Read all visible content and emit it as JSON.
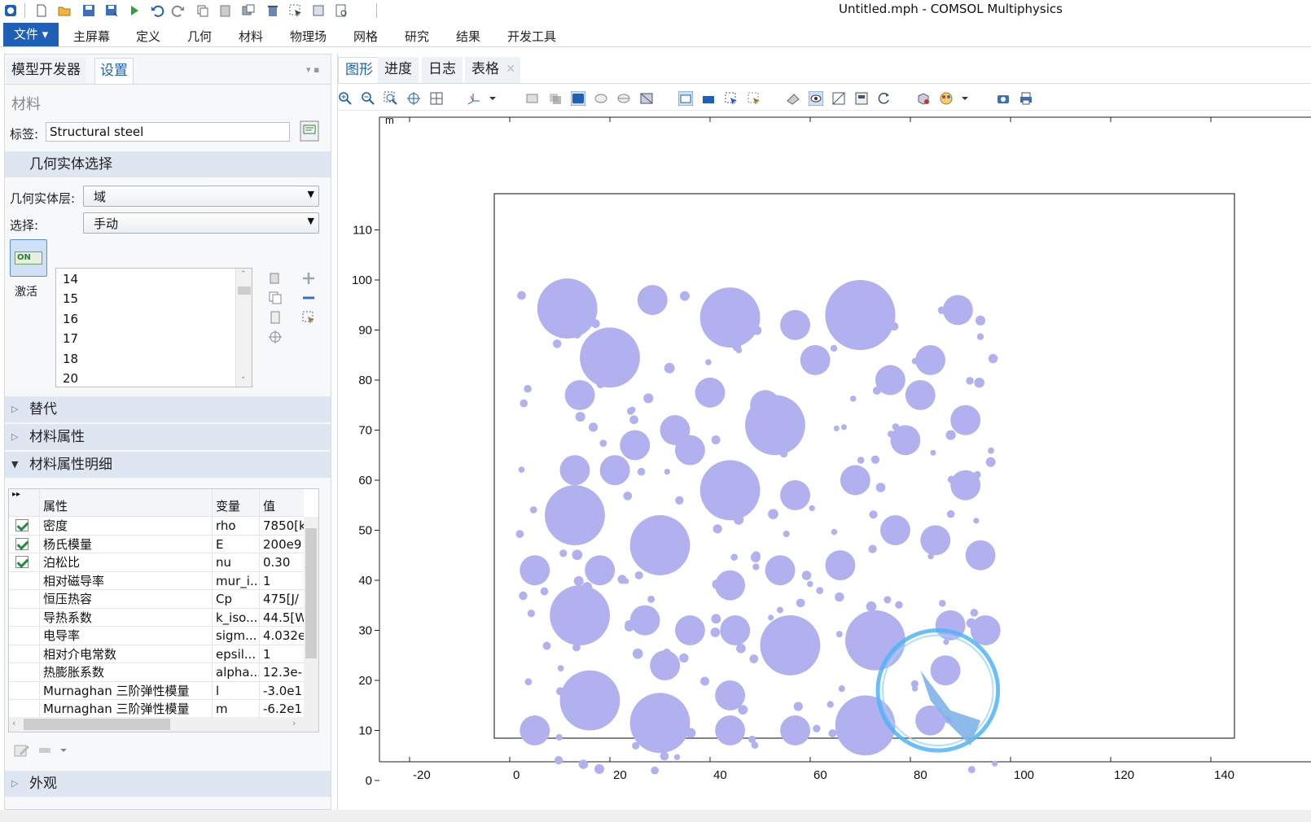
{
  "app": {
    "title": "Untitled.mph - COMSOL Multiphysics"
  },
  "ribbon": {
    "file_label": "文件 ▾",
    "tabs": [
      "主屏幕",
      "定义",
      "几何",
      "材料",
      "物理场",
      "网格",
      "研究",
      "结果",
      "开发工具"
    ]
  },
  "left": {
    "tabs": [
      "模型开发器",
      "设置"
    ],
    "section_title": "材料",
    "label_caption": "标签:",
    "label_value": "Structural steel",
    "geom_section": "几何实体选择",
    "level_caption": "几何实体层:",
    "level_value": "域",
    "selection_caption": "选择:",
    "selection_value": "手动",
    "activate_label": "激活",
    "toggle_text": "ON",
    "selection_items": [
      "14",
      "15",
      "16",
      "17",
      "18",
      "20"
    ],
    "sections": [
      "替代",
      "材料属性",
      "材料属性明细",
      "外观"
    ],
    "table": {
      "headers": [
        "属性",
        "变量",
        "值"
      ],
      "rows": [
        {
          "checked": true,
          "property": "密度",
          "variable": "rho",
          "value": "7850[k"
        },
        {
          "checked": true,
          "property": "杨氏模量",
          "variable": "E",
          "value": "200e9"
        },
        {
          "checked": true,
          "property": "泊松比",
          "variable": "nu",
          "value": "0.30"
        },
        {
          "checked": false,
          "property": "相对磁导率",
          "variable": "mur_i...",
          "value": "1"
        },
        {
          "checked": false,
          "property": "恒压热容",
          "variable": "Cp",
          "value": "475[J/"
        },
        {
          "checked": false,
          "property": "导热系数",
          "variable": "k_iso...",
          "value": "44.5[W"
        },
        {
          "checked": false,
          "property": "电导率",
          "variable": "sigm...",
          "value": "4.032e"
        },
        {
          "checked": false,
          "property": "相对介电常数",
          "variable": "epsil...",
          "value": "1"
        },
        {
          "checked": false,
          "property": "热膨胀系数",
          "variable": "alpha...",
          "value": "12.3e-"
        },
        {
          "checked": false,
          "property": "Murnaghan 三阶弹性模量",
          "variable": "l",
          "value": "-3.0e1"
        },
        {
          "checked": false,
          "property": "Murnaghan 三阶弹性模量",
          "variable": "m",
          "value": "-6.2e1"
        }
      ]
    }
  },
  "right": {
    "tabs": [
      "图形",
      "进度",
      "日志",
      "表格"
    ],
    "close_glyph": "✕"
  },
  "plot": {
    "unit": "m",
    "x_ticks": [
      "-20",
      "0",
      "20",
      "40",
      "60",
      "80",
      "100",
      "120",
      "140"
    ],
    "y_ticks": [
      "0",
      "10",
      "20",
      "30",
      "40",
      "50",
      "60",
      "70",
      "80",
      "90",
      "100",
      "110"
    ],
    "circle_color": "#b1b1ef",
    "circles": [
      [
        11.5,
        94.3,
        6
      ],
      [
        28.5,
        96,
        3
      ],
      [
        44,
        92.5,
        6
      ],
      [
        57,
        91,
        3
      ],
      [
        70,
        93,
        7
      ],
      [
        89.5,
        94,
        3
      ],
      [
        20,
        84.5,
        6
      ],
      [
        61,
        84,
        3
      ],
      [
        84,
        84,
        3
      ],
      [
        14,
        77,
        3
      ],
      [
        33,
        70,
        3
      ],
      [
        51,
        75,
        3
      ],
      [
        76,
        80,
        3
      ],
      [
        40,
        77.5,
        3
      ],
      [
        53,
        71,
        6
      ],
      [
        82,
        77,
        3
      ],
      [
        25,
        67,
        3
      ],
      [
        36,
        66,
        3
      ],
      [
        79,
        68,
        3
      ],
      [
        91,
        72,
        3
      ],
      [
        13,
        62,
        3
      ],
      [
        21,
        62,
        3
      ],
      [
        44,
        58,
        6
      ],
      [
        57,
        57,
        3
      ],
      [
        69,
        60,
        3
      ],
      [
        91,
        59,
        3
      ],
      [
        13,
        53,
        6
      ],
      [
        30,
        47,
        6
      ],
      [
        54,
        42,
        3
      ],
      [
        66,
        43,
        3
      ],
      [
        77,
        50,
        3
      ],
      [
        85,
        48,
        3
      ],
      [
        94,
        45,
        3
      ],
      [
        5,
        42,
        3
      ],
      [
        18,
        42,
        3
      ],
      [
        44,
        39,
        3
      ],
      [
        14,
        33,
        6
      ],
      [
        27,
        32,
        3
      ],
      [
        36,
        30,
        3
      ],
      [
        45,
        30,
        3
      ],
      [
        56,
        27,
        6
      ],
      [
        73,
        28,
        6
      ],
      [
        88,
        31,
        3
      ],
      [
        95,
        30,
        3
      ],
      [
        31,
        23,
        3
      ],
      [
        44,
        17,
        3
      ],
      [
        87,
        22,
        3
      ],
      [
        16,
        16,
        6
      ],
      [
        30,
        11.5,
        6
      ],
      [
        5,
        10,
        3
      ],
      [
        44,
        10,
        3
      ],
      [
        57,
        10,
        3
      ],
      [
        71,
        11,
        6
      ],
      [
        84,
        12,
        3
      ]
    ],
    "overlay_circle": [
      85.5,
      18,
      12
    ],
    "small_seed": 7
  }
}
